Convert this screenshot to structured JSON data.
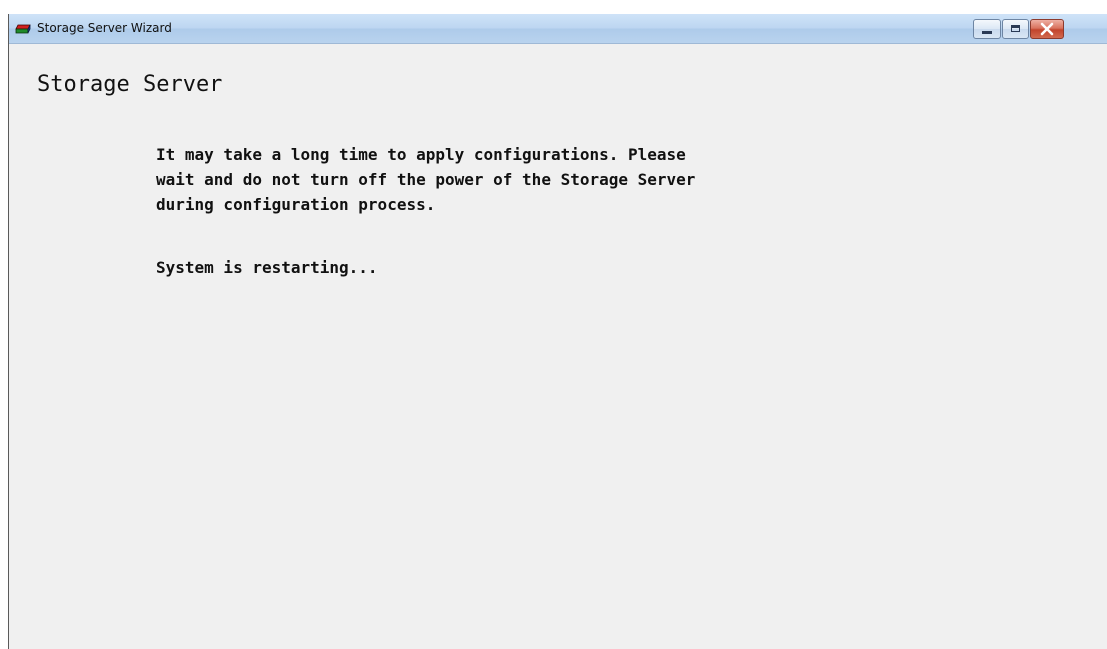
{
  "window": {
    "title": "Storage Server Wizard",
    "app_icon": "storage-server-icon",
    "controls": {
      "minimize_icon": "minimize-icon",
      "maximize_icon": "maximize-icon",
      "close_icon": "close-icon",
      "close_color": "#c2442c"
    }
  },
  "main": {
    "heading": "Storage Server",
    "message": "It may take a long time to apply configurations. Please\nwait and do not turn off the power of the Storage Server\nduring configuration process.",
    "status": "System is restarting..."
  },
  "colors": {
    "background": "#f0f0f0",
    "titlebar": "#bdd6f1",
    "text": "#111111"
  }
}
